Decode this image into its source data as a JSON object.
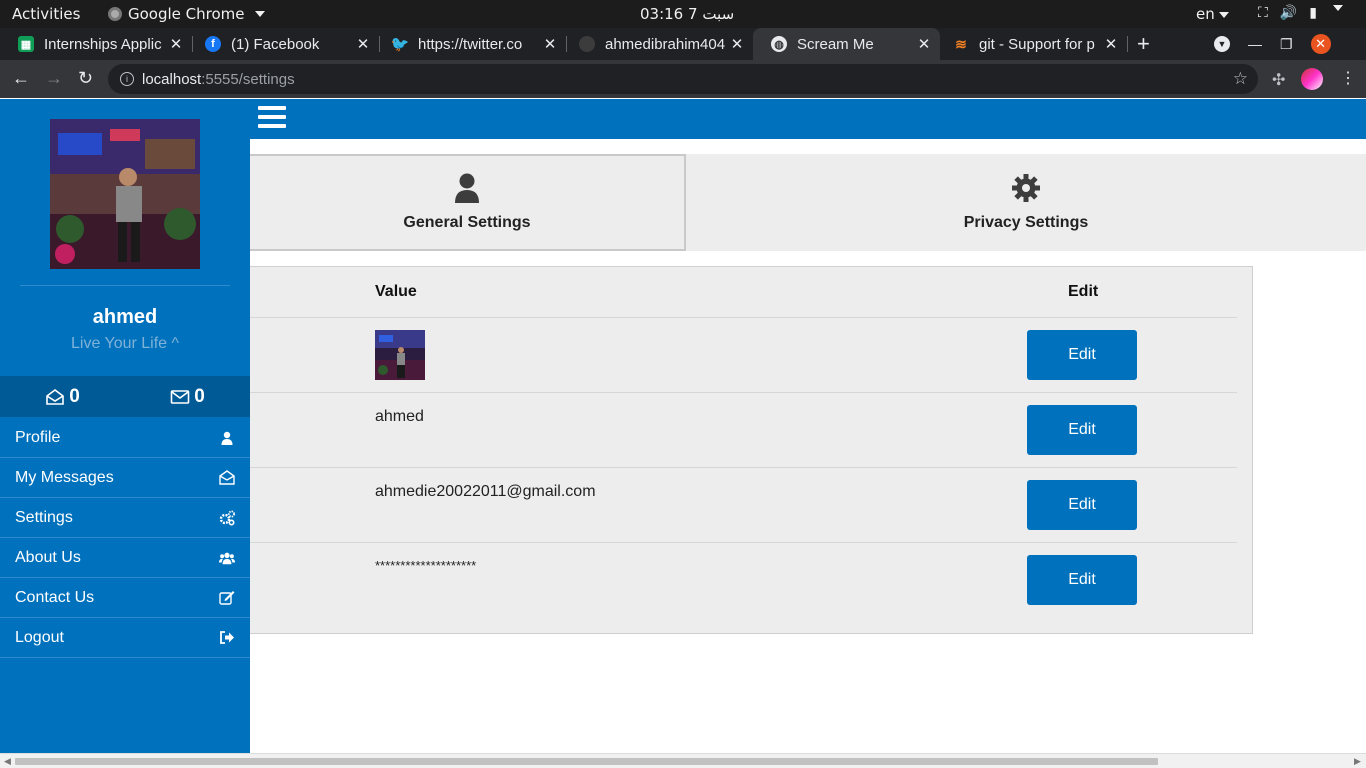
{
  "system_bar": {
    "activities": "Activities",
    "app_name": "Google Chrome",
    "clock": "03:16  سبت 7",
    "lang": "en"
  },
  "browser": {
    "tabs": [
      {
        "title": "Internships Applic",
        "icon": "google-sheets-icon",
        "color": "#0f9d58"
      },
      {
        "title": "(1) Facebook",
        "icon": "facebook-icon",
        "color": "#1877f2"
      },
      {
        "title": "https://twitter.co",
        "icon": "twitter-icon",
        "color": "#1da1f2"
      },
      {
        "title": "ahmedibrahim404",
        "icon": "github-icon",
        "color": "#24292e"
      },
      {
        "title": "Scream Me",
        "icon": "globe-icon",
        "color": "#9aa0a6"
      },
      {
        "title": "git - Support for p",
        "icon": "stackoverflow-icon",
        "color": "#f48024"
      }
    ],
    "url_host": "localhost",
    "url_path": ":5555/settings"
  },
  "sidebar": {
    "username": "ahmed",
    "status": "Live Your Life ^",
    "inbox_count": "0",
    "mail_count": "0",
    "items": [
      {
        "label": "Profile",
        "icon": "user-icon"
      },
      {
        "label": "My Messages",
        "icon": "envelope-open-icon"
      },
      {
        "label": "Settings",
        "icon": "cogs-icon"
      },
      {
        "label": "About Us",
        "icon": "users-icon"
      },
      {
        "label": "Contact Us",
        "icon": "edit-icon"
      },
      {
        "label": "Logout",
        "icon": "sign-out-icon"
      }
    ]
  },
  "settings_tabs": {
    "general": "General Settings",
    "privacy": "Privacy Settings"
  },
  "table": {
    "col_value": "Value",
    "col_edit": "Edit",
    "rows": [
      {
        "value": "",
        "type": "image",
        "edit_label": "Edit"
      },
      {
        "value": "ahmed",
        "type": "text",
        "edit_label": "Edit"
      },
      {
        "value": "ahmedie20022011@gmail.com",
        "type": "text",
        "edit_label": "Edit"
      },
      {
        "value": "********************",
        "type": "text",
        "edit_label": "Edit"
      }
    ]
  },
  "colors": {
    "brand": "#0071bc",
    "brand_dark": "#005a96",
    "panel": "#ededed"
  }
}
